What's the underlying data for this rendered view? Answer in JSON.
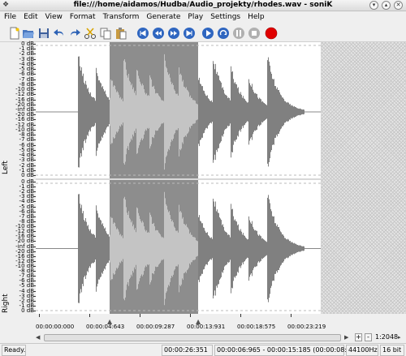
{
  "window": {
    "title": "file:///home/aidamos/Hudba/Audio_projekty/rhodes.wav - soniK"
  },
  "menu": [
    "File",
    "Edit",
    "View",
    "Format",
    "Transform",
    "Generate",
    "Play",
    "Settings",
    "Help"
  ],
  "toolbar": {
    "icons": [
      "new-file-icon",
      "open-file-icon",
      "save-icon",
      "undo-icon",
      "redo-icon",
      "cut-icon",
      "copy-icon",
      "paste-icon",
      "zoom-to-start-icon",
      "rewind-icon",
      "fast-forward-icon",
      "zoom-to-end-icon",
      "play-icon",
      "loop-icon",
      "pause-icon",
      "stop-icon",
      "record-icon"
    ],
    "record_color": "#e00000"
  },
  "channels": {
    "left": "Left",
    "right": "Right"
  },
  "db_scale": [
    "0 dB",
    "-1 dB",
    "-2 dB",
    "-3 dB",
    "-4 dB",
    "-5 dB",
    "-6 dB",
    "-7 dB",
    "-8 dB",
    "-10 dB",
    "-12 dB",
    "-16 dB",
    "-20 dB",
    "-inf dB",
    "-20 dB",
    "-16 dB",
    "-12 dB",
    "-10 dB",
    "-8 dB",
    "-7 dB",
    "-6 dB",
    "-5 dB",
    "-4 dB",
    "-3 dB",
    "-2 dB",
    "-1 dB",
    "0 dB"
  ],
  "time_ticks": [
    "00:00:00:000",
    "00:00:04:643",
    "00:00:09:287",
    "00:00:13:931",
    "00:00:18:575",
    "00:00:23:219"
  ],
  "zoom": {
    "label": "1:2048",
    "plus": "+",
    "minus": "-"
  },
  "status": {
    "state": "Ready.",
    "length": "00:00:26:351",
    "selection": "00:00:06:965 - 00:00:15:185 (00:00:08:219)",
    "rate": "44100Hz",
    "bits": "16 bit"
  },
  "colors": {
    "selection": "#8d8d8d",
    "waveform": "#808080",
    "waveform_selected": "#c4c4c4"
  }
}
